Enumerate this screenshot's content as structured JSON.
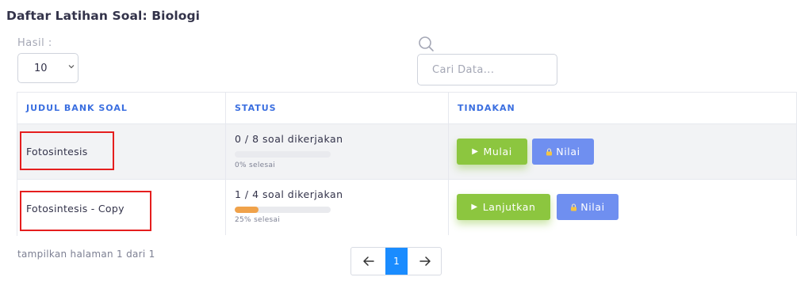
{
  "page": {
    "title": "Daftar Latihan Soal: Biologi"
  },
  "filters": {
    "results_label": "Hasil :",
    "results_value": "10",
    "search_placeholder": "Cari Data..."
  },
  "table": {
    "headers": [
      "JUDUL BANK SOAL",
      "STATUS",
      "TINDAKAN"
    ],
    "rows": [
      {
        "title": "Fotosintesis",
        "status": "0 / 8 soal dikerjakan",
        "progress": 0,
        "progress_label": "0% selesai",
        "primary_action": "Mulai",
        "secondary_action": "Nilai",
        "highlighted": true
      },
      {
        "title": "Fotosintesis - Copy",
        "status": "1 / 4 soal dikerjakan",
        "progress": 0.25,
        "progress_label": "25% selesai",
        "primary_action": "Lanjutkan",
        "secondary_action": "Nilai",
        "highlighted": true
      }
    ]
  },
  "footer": {
    "page_info": "tampilkan halaman 1 dari 1",
    "current_page": "1"
  },
  "icons": {
    "search": "search-icon",
    "chevron": "chevron-down-icon",
    "play": "play-icon",
    "lock": "lock-icon",
    "prev": "arrow-left-icon",
    "next": "arrow-right-icon"
  },
  "colors": {
    "header_text": "#3b6fe0",
    "primary_button": "#8cc63f",
    "secondary_button": "#6f8ff0",
    "progress_fill": "#f0a24a",
    "active_page": "#1a8cff",
    "highlight_border": "#e51e1e"
  }
}
